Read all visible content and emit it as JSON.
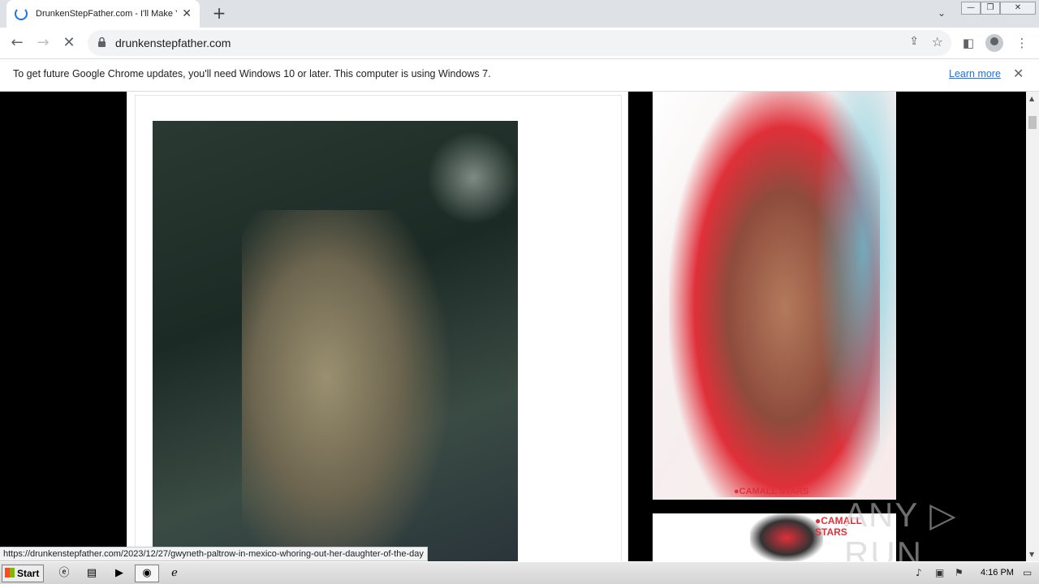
{
  "browser": {
    "tab_title": "DrunkenStepFather.com - I'll Make Y",
    "url": "drunkenstepfather.com",
    "infobar_message": "To get future Google Chrome updates, you'll need Windows 10 or later. This computer is using Windows 7.",
    "infobar_link": "Learn more",
    "status_url": "https://drunkenstepfather.com/2023/12/27/gwyneth-paltrow-in-mexico-whoring-out-her-daughter-of-the-day"
  },
  "ads": {
    "ad1_brand": "●CAMALL STARS",
    "ad2_brand": "●CAMALL STARS"
  },
  "watermark": "ANY ▷ RUN",
  "taskbar": {
    "start_label": "Start",
    "clock": "4:16 PM"
  }
}
